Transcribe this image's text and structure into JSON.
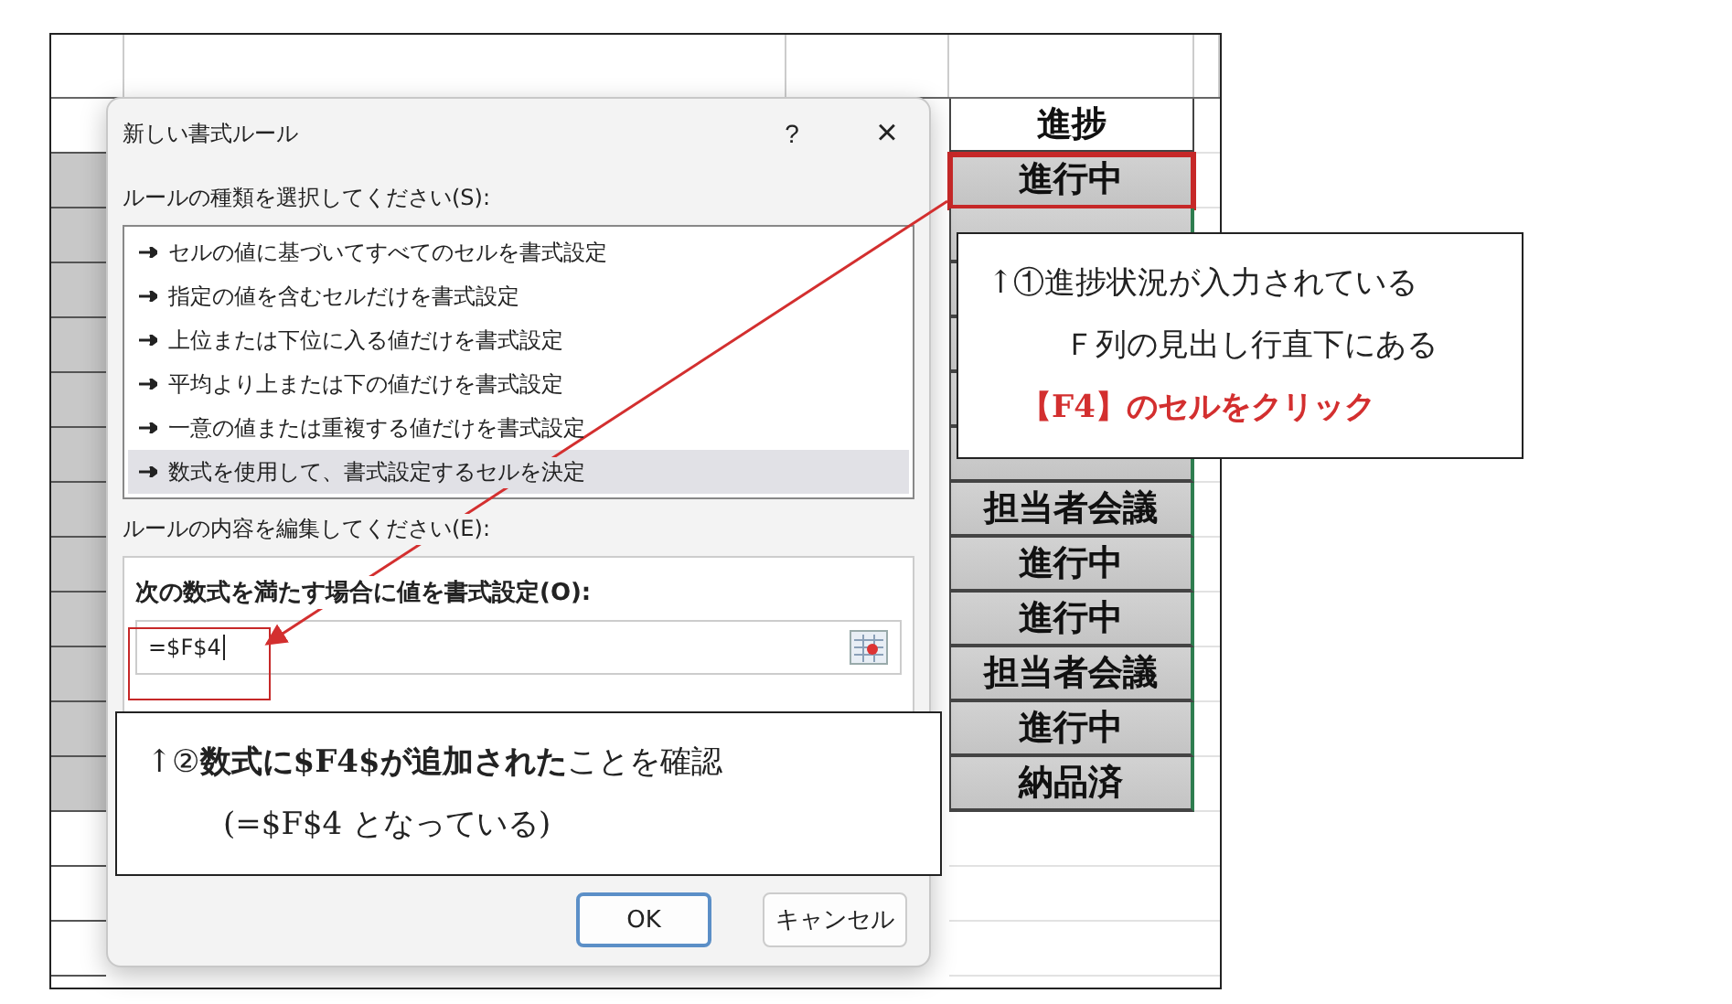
{
  "sheet": {
    "rows": [
      {
        "kind": "header",
        "status": "進捗",
        "highlighted": false
      },
      {
        "kind": "data",
        "status": "進行中",
        "highlighted": true
      },
      {
        "kind": "data",
        "highlighted": false
      },
      {
        "kind": "data",
        "highlighted": false
      },
      {
        "kind": "data",
        "highlighted": false
      },
      {
        "kind": "data",
        "highlighted": false
      },
      {
        "kind": "data",
        "highlighted": false
      },
      {
        "kind": "data",
        "status": "担当者会議",
        "highlighted": false
      },
      {
        "kind": "data",
        "status": "進行中",
        "highlighted": false
      },
      {
        "kind": "data",
        "status": "進行中",
        "highlighted": false
      },
      {
        "kind": "data",
        "status": "担当者会議",
        "highlighted": false
      },
      {
        "kind": "data",
        "status": "進行中",
        "highlighted": false
      },
      {
        "kind": "data",
        "status": "納品済",
        "highlighted": false
      }
    ]
  },
  "dialog": {
    "title": "新しい書式ルール",
    "help": "?",
    "close": "×",
    "rule_type_label": "ルールの種類を選択してください(S):",
    "rule_types": [
      {
        "label": "セルの値に基づいてすべてのセルを書式設定",
        "selected": false
      },
      {
        "label": "指定の値を含むセルだけを書式設定",
        "selected": false
      },
      {
        "label": "上位または下位に入る値だけを書式設定",
        "selected": false
      },
      {
        "label": "平均より上または下の値だけを書式設定",
        "selected": false
      },
      {
        "label": "一意の値または重複する値だけを書式設定",
        "selected": false
      },
      {
        "label": "数式を使用して、書式設定するセルを決定",
        "selected": true
      }
    ],
    "edit_label": "ルールの内容を編集してください(E):",
    "formula_label": "次の数式を満たす場合に値を書式設定(O):",
    "formula": "=$F$4",
    "buttons": [
      {
        "label": "OK",
        "default": true
      },
      {
        "label": "キャンセル",
        "default": false
      }
    ]
  },
  "callouts": [
    {
      "lines": [
        {
          "text": "↑①進捗状況が入力されている",
          "kind": "normal"
        },
        {
          "text": "Ｆ列の見出し行直下にある",
          "kind": "indent"
        },
        {
          "text": "【F4】のセルをクリック",
          "kind": "emphasis"
        }
      ]
    },
    {
      "lines": [
        {
          "text": "↑②**数式に$F4$が追加された**ことを確認",
          "kind": "normal"
        },
        {
          "text": "(=$F$4 となっている)",
          "kind": "indent"
        }
      ]
    }
  ]
}
